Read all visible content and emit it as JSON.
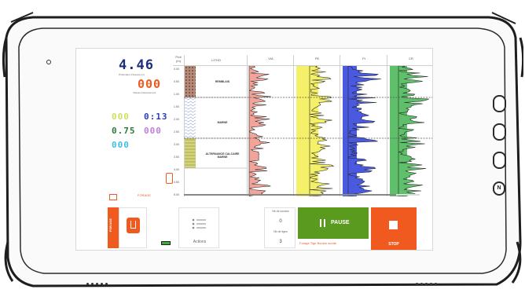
{
  "readouts": {
    "depth_main": "4.46",
    "depth_main_caption": "Profondeur d'avance (m)",
    "depth_secondary": "000",
    "depth_secondary_caption": "Vitesse d'avancement",
    "green_val": "000",
    "blue_val": "0:13",
    "row2_left": "0.75",
    "row2_right": "000",
    "row3_left": "000"
  },
  "colors": {
    "accent_orange": "#f05a1e",
    "pause_green": "#5a9a1e",
    "yellow_band": "#f5f06a",
    "blue_band": "#4a5ae0",
    "green_band": "#5fbf6a",
    "readout_blue": "#1e2f7a",
    "readout_orange": "#f05a1e"
  },
  "log": {
    "depth_header": "Prof (m)",
    "lithology_header": "LITHO",
    "headers": [
      "VIA",
      "PE",
      "PI",
      "CR"
    ],
    "depth_ticks": [
      "0.00",
      "0.50",
      "1.00",
      "1.50",
      "2.00",
      "2.50",
      "3.00",
      "3.50",
      "4.00",
      "4.50",
      "5.00"
    ],
    "lithology": [
      "REMBLAIS",
      "MARNE",
      "ALTERNANCE CALCAIRE MARNE"
    ]
  },
  "labels": {
    "forage": "FORAGE",
    "tab_side": "FORAGE",
    "actions": "Actions",
    "nb_sondes_label": "Nb de sondes",
    "nb_sondes_value": "0",
    "nb_tiges_label": "Nb de tiges",
    "nb_tiges_value": "3",
    "pause": "PAUSE",
    "stop": "STOP",
    "status": "Forage Tige Bouton sonde"
  },
  "icons": [
    "orange-tab-icon",
    "menu-list-icon",
    "battery-icon",
    "pause-icon",
    "stop-icon",
    "camera-icon"
  ]
}
